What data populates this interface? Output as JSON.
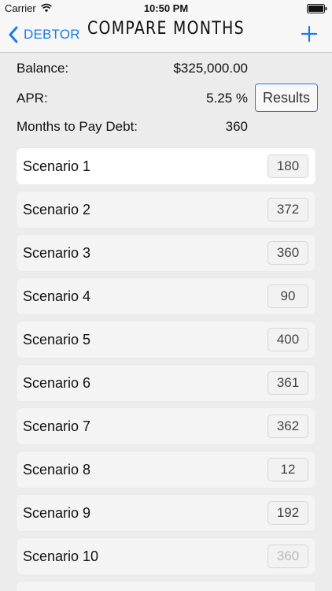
{
  "status_bar": {
    "carrier": "Carrier",
    "time": "10:50 PM"
  },
  "nav": {
    "back_label": "DEBTOR",
    "title": "COMPARE MONTHS"
  },
  "summary": {
    "balance_label": "Balance:",
    "balance_value": "$325,000.00",
    "apr_label": "APR:",
    "apr_value": "5.25 %",
    "months_label": "Months to Pay Debt:",
    "months_value": "360",
    "results_label": "Results"
  },
  "scenarios": [
    {
      "label": "Scenario 1",
      "value": "180"
    },
    {
      "label": "Scenario 2",
      "value": "372"
    },
    {
      "label": "Scenario 3",
      "value": "360"
    },
    {
      "label": "Scenario 4",
      "value": "90"
    },
    {
      "label": "Scenario 5",
      "value": "400"
    },
    {
      "label": "Scenario 6",
      "value": "361"
    },
    {
      "label": "Scenario 7",
      "value": "362"
    },
    {
      "label": "Scenario 8",
      "value": "12"
    },
    {
      "label": "Scenario 9",
      "value": "192"
    },
    {
      "label": "Scenario 10",
      "value": "",
      "placeholder": "360"
    }
  ],
  "colors": {
    "accent": "#1e7be6",
    "background": "#ececec"
  },
  "icons": {
    "wifi": "wifi-icon",
    "battery": "battery-icon",
    "back": "chevron-left-icon",
    "add": "plus-icon"
  }
}
